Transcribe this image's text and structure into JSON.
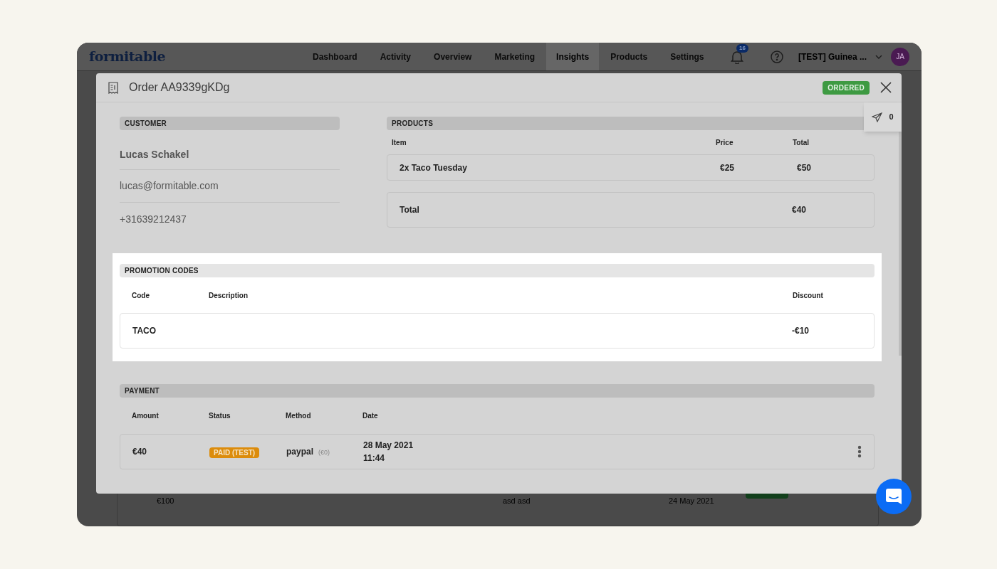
{
  "app": {
    "logo": "formitable",
    "nav": [
      {
        "label": "Dashboard",
        "selected": false
      },
      {
        "label": "Activity",
        "selected": false
      },
      {
        "label": "Overview",
        "selected": false
      },
      {
        "label": "Marketing",
        "selected": false
      },
      {
        "label": "Insights",
        "selected": true
      },
      {
        "label": "Products",
        "selected": false
      },
      {
        "label": "Settings",
        "selected": false
      }
    ],
    "notification_count": "16",
    "account": "[TEST] Guinea ...",
    "avatar": "JA"
  },
  "background_row": {
    "price": "€100",
    "text": "asd asd",
    "date": "24 May 2021"
  },
  "modal": {
    "title": "Order AA9339gKDg",
    "status": "ORDERED",
    "messages_count": "0",
    "customer": {
      "heading": "CUSTOMER",
      "name": "Lucas Schakel",
      "email": "lucas@formitable.com",
      "phone": "+31639212437"
    },
    "products": {
      "heading": "PRODUCTS",
      "columns": [
        "Item",
        "Price",
        "Total"
      ],
      "rows": [
        {
          "item": "2x Taco Tuesday",
          "price": "€25",
          "total": "€50"
        }
      ],
      "total_label": "Total",
      "total_value": "€40"
    },
    "promotion_codes": {
      "heading": "PROMOTION CODES",
      "highlighted": true,
      "columns": [
        "Code",
        "Description",
        "Discount"
      ],
      "rows": [
        {
          "code": "TACO",
          "discount": "-€10"
        }
      ]
    },
    "payment": {
      "heading": "PAYMENT",
      "columns": [
        "Amount",
        "Status",
        "Method",
        "Date"
      ],
      "rows": [
        {
          "amount": "€40",
          "status": "PAID (TEST)",
          "method": "paypal",
          "method_amount": "(€0)",
          "date": "28 May 2021",
          "time": "11:44"
        }
      ]
    }
  }
}
